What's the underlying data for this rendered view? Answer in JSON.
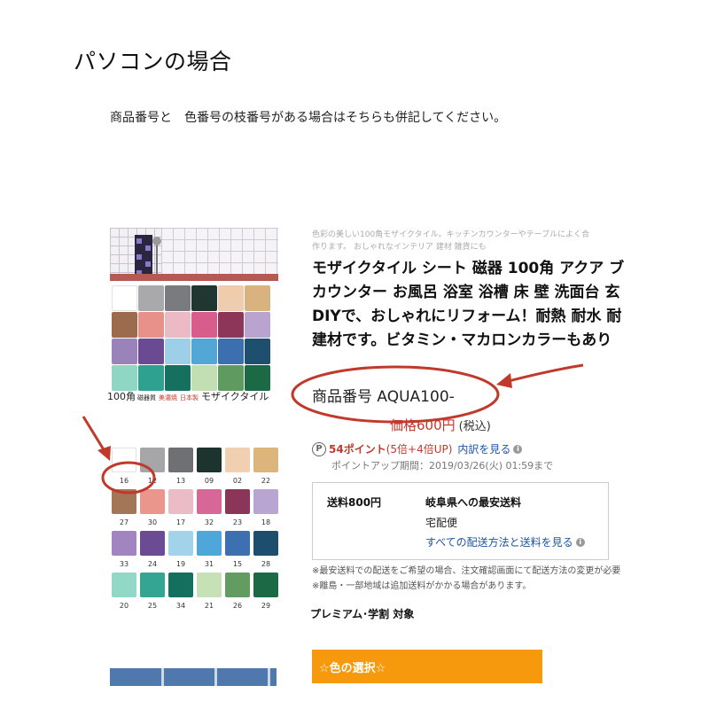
{
  "heading": "パソコンの場合",
  "instruction": "商品番号と　色番号の枝番号がある場合はそちらも併記してください。",
  "product_image": {
    "caption_main": "100角",
    "caption_tag1": "磁器質",
    "caption_tag2": "美濃焼",
    "caption_tag3": "日本製",
    "caption_name": "モザイクタイル"
  },
  "tile_grid_colors": [
    "#ffffff",
    "#a9a9ab",
    "#7a7b7f",
    "#1f3631",
    "#f0ccae",
    "#d9b37f",
    "#9c6b4e",
    "#e8918a",
    "#ebbac4",
    "#d85c8c",
    "#8e3659",
    "#b8a4cf",
    "#9a83b9",
    "#6a4a92",
    "#9ecfe9",
    "#53a7d6",
    "#3b6fb0",
    "#1e4f6e",
    "#8fd6c4",
    "#2ea190",
    "#157060",
    "#c2dfb4",
    "#5f9a5e",
    "#1c6a45"
  ],
  "color_swatches": [
    {
      "code": "16",
      "color": "#ffffff"
    },
    {
      "code": "12",
      "color": "#a6a6a8"
    },
    {
      "code": "13",
      "color": "#6f7074"
    },
    {
      "code": "09",
      "color": "#1d332e"
    },
    {
      "code": "02",
      "color": "#f1cfb1"
    },
    {
      "code": "22",
      "color": "#dcb57d"
    },
    {
      "code": "27",
      "color": "#a27656"
    },
    {
      "code": "30",
      "color": "#ea968d"
    },
    {
      "code": "17",
      "color": "#ecbcc6"
    },
    {
      "code": "32",
      "color": "#d76797"
    },
    {
      "code": "23",
      "color": "#8b3559"
    },
    {
      "code": "18",
      "color": "#b9a5d1"
    },
    {
      "code": "33",
      "color": "#a184c0"
    },
    {
      "code": "24",
      "color": "#6b4b93"
    },
    {
      "code": "19",
      "color": "#a3d3ea"
    },
    {
      "code": "31",
      "color": "#4fa6d8"
    },
    {
      "code": "15",
      "color": "#3d70b1"
    },
    {
      "code": "28",
      "color": "#1d4e6e"
    },
    {
      "code": "20",
      "color": "#92d8c6"
    },
    {
      "code": "25",
      "color": "#33a592"
    },
    {
      "code": "34",
      "color": "#146f5e"
    },
    {
      "code": "21",
      "color": "#c6e1b6"
    },
    {
      "code": "26",
      "color": "#639c61"
    },
    {
      "code": "29",
      "color": "#1b6a45"
    }
  ],
  "product": {
    "catch_copy_1": "色彩の美しい100角モザイクタイル。キッチンカウンターやテーブルによく合",
    "catch_copy_2": "作ります。 おしゃれなインテリア 建材 雑貨にも",
    "title_1": "モザイクタイル シート 磁器 100角 アクア ブ",
    "title_2": "カウンター お風呂 浴室 浴槽 床 壁 洗面台 玄",
    "title_3": "DIYで、おしゃれにリフォーム！耐熱 耐水 耐",
    "title_4": "建材です。ビタミン・マカロンカラーもあり",
    "item_number": "商品番号 AQUA100-",
    "price": "価格600円",
    "tax": "(税込)"
  },
  "points": {
    "icon_letter": "P",
    "value": "54ポイント",
    "multiplier": "(5倍+4倍UP)",
    "detail_link": "内訳を見る",
    "period": "ポイントアップ期間：2019/03/26(火) 01:59まで"
  },
  "shipping": {
    "fee": "送料800円",
    "destination": "岐阜県への最安送料",
    "method": "宅配便",
    "all_methods_link": "すべての配送方法と送料を見る"
  },
  "notes": {
    "line1": "※最安送料での配送をご希望の場合、注文確認画面にて配送方法の変更が必要",
    "line2": "※離島・一部地域は追加送料がかかる場合があります。"
  },
  "premium": "プレミアム･学割 対象",
  "color_select_label": "☆色の選択☆",
  "annotation_colors": {
    "highlight": "#c0392b"
  }
}
